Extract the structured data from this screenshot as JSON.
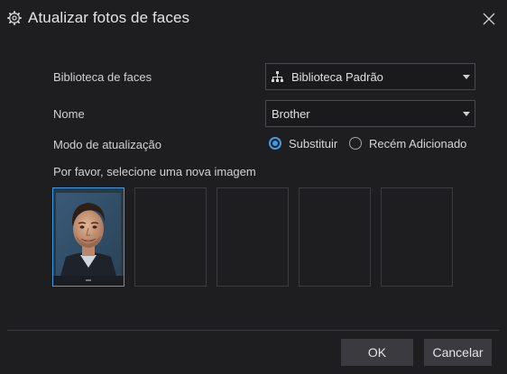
{
  "dialog": {
    "title": "Atualizar fotos de faces",
    "title_icon": "gear-icon",
    "close_icon": "close-icon"
  },
  "form": {
    "library_label": "Biblioteca de faces",
    "library_value": "Biblioteca Padrão",
    "library_icon": "org-tree-icon",
    "name_label": "Nome",
    "name_value": "Brother",
    "mode_label": "Modo de atualização",
    "mode_options": [
      {
        "label": "Substituir",
        "checked": true
      },
      {
        "label": "Recém Adicionado",
        "checked": false
      }
    ],
    "image_prompt": "Por favor, selecione uma nova imagem"
  },
  "images": {
    "slots": [
      {
        "state": "filled",
        "content": "face-photo"
      },
      {
        "state": "empty"
      },
      {
        "state": "empty"
      },
      {
        "state": "empty"
      },
      {
        "state": "empty"
      }
    ]
  },
  "buttons": {
    "ok": "OK",
    "cancel": "Cancelar"
  },
  "colors": {
    "accent": "#3f9de5",
    "background": "#1e1e21",
    "button": "#3a3a3f"
  }
}
